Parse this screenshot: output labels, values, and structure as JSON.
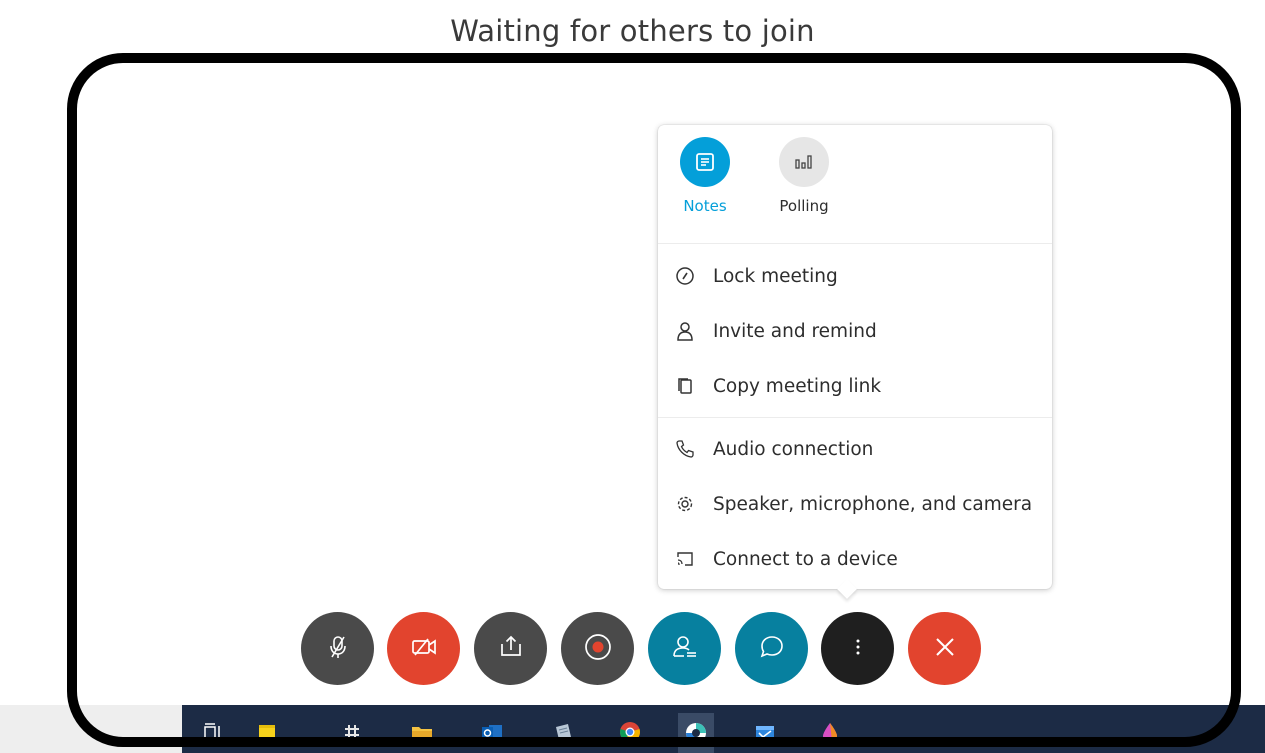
{
  "page": {
    "heading": "Waiting for others to join"
  },
  "menu": {
    "apps": [
      {
        "label": "Notes",
        "icon": "notes-icon",
        "color": "#049fd9",
        "active": true
      },
      {
        "label": "Polling",
        "icon": "polling-icon",
        "active": false
      }
    ],
    "items": [
      {
        "label": "Lock meeting",
        "icon": "lock-meeting-icon"
      },
      {
        "label": "Invite and remind",
        "icon": "person-icon"
      },
      {
        "label": "Copy meeting link",
        "icon": "copy-icon"
      },
      {
        "label": "Audio connection",
        "icon": "phone-icon"
      },
      {
        "label": "Speaker, microphone, and camera",
        "icon": "gear-icon"
      },
      {
        "label": "Connect to a device",
        "icon": "cast-device-icon"
      }
    ]
  },
  "controls": [
    {
      "name": "mute-button",
      "icon": "microphone-muted-icon",
      "color": "#4a4a4a"
    },
    {
      "name": "stop-video-button",
      "icon": "camera-off-icon",
      "color": "#e2442e"
    },
    {
      "name": "share-button",
      "icon": "share-icon",
      "color": "#4a4a4a"
    },
    {
      "name": "record-button",
      "icon": "record-icon",
      "color": "#4a4a4a"
    },
    {
      "name": "participants-button",
      "icon": "participants-icon",
      "color": "#07809f"
    },
    {
      "name": "chat-button",
      "icon": "chat-icon",
      "color": "#07809f"
    },
    {
      "name": "more-options-button",
      "icon": "more-vertical-icon",
      "color": "#1f1f1f"
    },
    {
      "name": "leave-meeting-button",
      "icon": "close-icon",
      "color": "#e2442e"
    }
  ],
  "taskbar": {
    "apps": [
      "task-view-icon",
      "sticky-notes-icon",
      "slack-icon",
      "file-explorer-icon",
      "outlook-icon",
      "notepad-icon",
      "chrome-icon",
      "webex-icon",
      "calendar-app-icon",
      "paint-icon"
    ]
  }
}
